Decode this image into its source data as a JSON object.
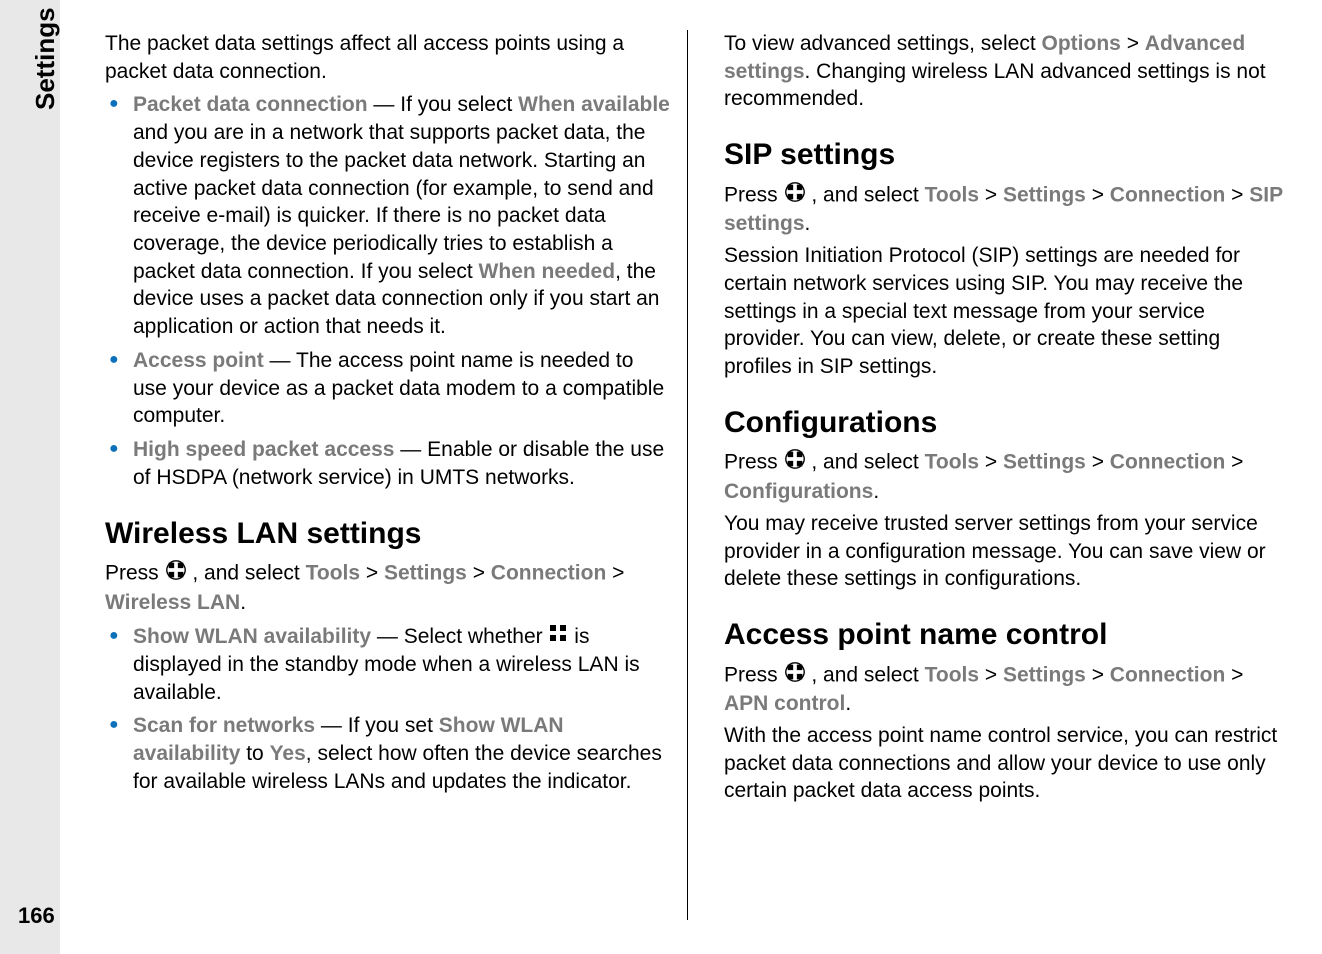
{
  "sidebar": {
    "title": "Settings"
  },
  "pageNumber": "166",
  "left": {
    "intro": "The packet data settings affect all access points using a packet data connection.",
    "bullets": {
      "pdc_label": "Packet data connection",
      "pdc_a": " — If you select ",
      "pdc_whenAvail": "When available",
      "pdc_b": " and you are in a network that supports packet data, the device registers to the packet data network. Starting an active packet data connection (for example, to send and receive e-mail) is quicker. If there is no packet data coverage, the device periodically tries to establish a packet data connection. If you select ",
      "pdc_whenNeeded": "When needed",
      "pdc_c": ", the device uses a packet data connection only if you start an application or action that needs it.",
      "ap_label": "Access point",
      "ap_txt": " — The access point name is needed to use your device as a packet data modem to a compatible computer.",
      "hspa_label": "High speed packet access",
      "hspa_txt": " — Enable or disable the use of HSDPA (network service) in UMTS networks."
    },
    "wlan_heading": "Wireless LAN settings",
    "wlan_press": "Press ",
    "wlan_press2": " , and select ",
    "tools": "Tools",
    "gt": ">",
    "settings": "Settings",
    "connection": "Connection",
    "wirelessLan": "Wireless LAN",
    "dot": ".",
    "wlan_bullets": {
      "show_label": "Show WLAN availability",
      "show_a": " — Select whether ",
      "show_b": " is displayed in the standby mode when a wireless LAN is available.",
      "scan_label": "Scan for networks",
      "scan_a": " — If you set ",
      "scan_showAvail": "Show WLAN availability",
      "scan_b": " to ",
      "scan_yes": "Yes",
      "scan_c": ", select how often the device searches for available wireless LANs and updates the indicator."
    }
  },
  "right": {
    "adv_a": "To view advanced settings, select ",
    "adv_options": "Options",
    "adv_gt": ">",
    "adv_settings": "Advanced settings",
    "adv_b": ". Changing wireless LAN advanced settings is not recommended.",
    "sip_heading": "SIP settings",
    "press": "Press ",
    "press2": " , and select ",
    "tools": "Tools",
    "gt": ">",
    "settings": "Settings",
    "connection": "Connection",
    "sipSettings": "SIP settings",
    "dot": ".",
    "sip_body": "Session Initiation Protocol (SIP) settings are needed for certain network services using SIP. You may receive the settings in a special text message from your service provider. You can view, delete, or create these setting profiles in SIP settings.",
    "conf_heading": "Configurations",
    "configurations": "Configurations",
    "conf_body": "You may receive trusted server settings from your service provider in a configuration message. You can save view or delete these settings in configurations.",
    "apn_heading": "Access point name control",
    "apnControl": "APN control",
    "apn_body": "With the access point name control service, you can restrict packet data connections and allow your device to use only certain packet data access points."
  }
}
